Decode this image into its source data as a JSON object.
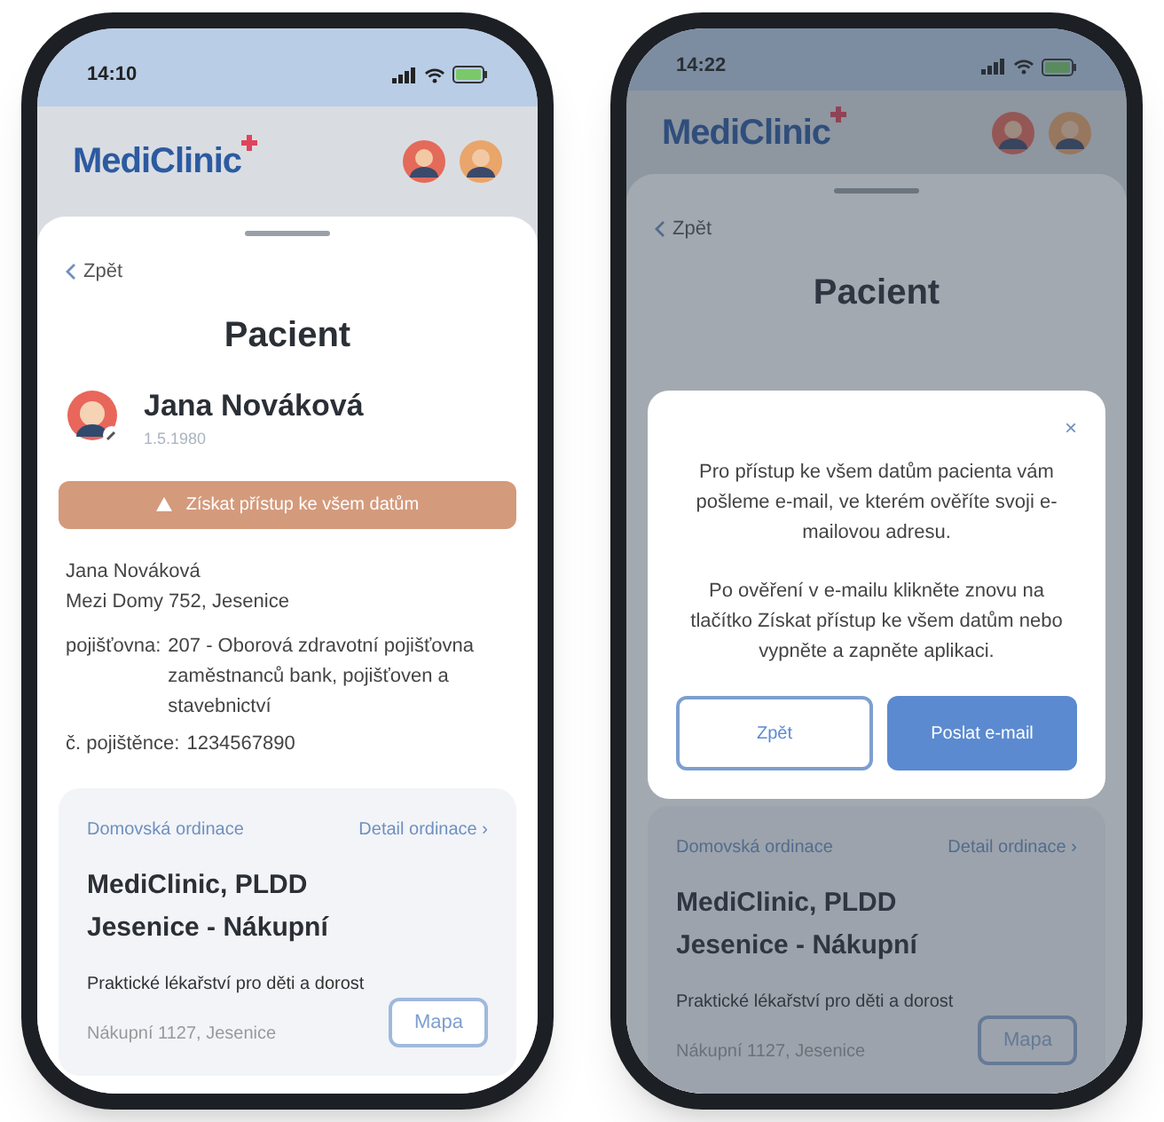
{
  "phones": [
    {
      "time": "14:10",
      "logo": "MediClinic",
      "back": "Zpět",
      "title": "Pacient",
      "dimmed": false,
      "patient": {
        "name": "Jana Nováková",
        "dob": "1.5.1980"
      },
      "alert_button": "Získat přístup ke všem datům",
      "address": [
        "Jana Nováková",
        "Mezi Domy 752, Jesenice"
      ],
      "insurance": [
        {
          "label": "pojišťovna:",
          "value": "207 - Oborová zdravotní pojišťovna zaměstnanců bank, pojišťoven a stavebnictví"
        },
        {
          "label": "č. pojištěnce:",
          "value": "1234567890"
        }
      ],
      "card": {
        "heading": "Domovská ordinace",
        "link": "Detail ordinace",
        "chevron": "›",
        "name": [
          "MediClinic, PLDD",
          "Jesenice - Nákupní"
        ],
        "specialty": "Praktické lékařství pro děti a dorost",
        "address": "Nákupní 1127, Jesenice",
        "map_button": "Mapa"
      }
    },
    {
      "time": "14:22",
      "logo": "MediClinic",
      "back": "Zpět",
      "title": "Pacient",
      "dimmed": true,
      "dialog": {
        "close": "×",
        "paragraphs": [
          "Pro přístup ke všem datům pacienta vám pošleme e-mail, ve kterém ověříte svoji e-mailovou adresu.",
          "Po ověření v e-mailu klikněte znovu na tlačítko Získat přístup ke všem datům nebo vypněte a zapněte aplikaci."
        ],
        "buttons": [
          {
            "label": "Zpět",
            "kind": "secondary"
          },
          {
            "label": "Poslat e-mail",
            "kind": "primary"
          }
        ]
      },
      "card": {
        "heading": "Domovská ordinace",
        "link": "Detail ordinace",
        "chevron": "›",
        "name": [
          "MediClinic, PLDD",
          "Jesenice - Nákupní"
        ],
        "specialty": "Praktické lékařství pro děti a dorost",
        "address": "Nákupní 1127, Jesenice",
        "map_button": "Mapa"
      }
    }
  ]
}
